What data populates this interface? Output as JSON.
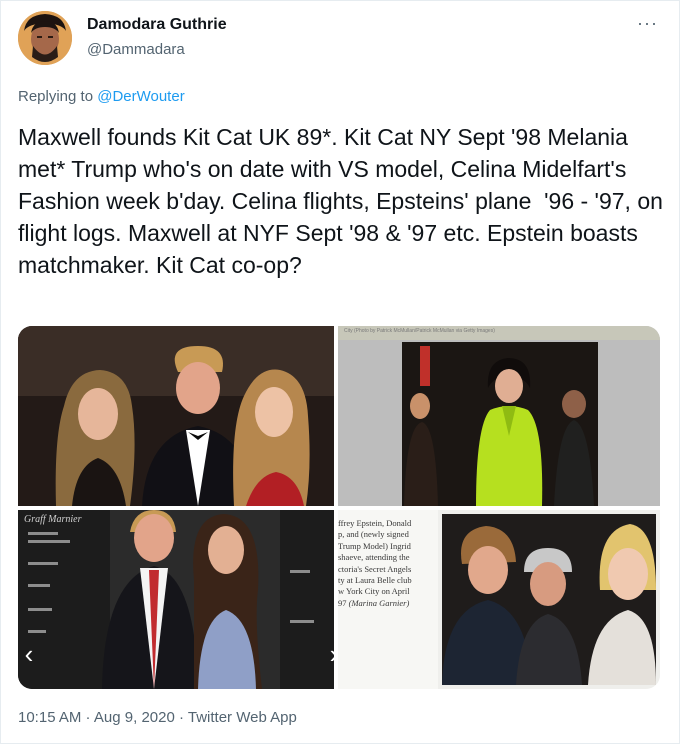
{
  "author": {
    "name": "Damodara Guthrie",
    "handle": "@Dammadara"
  },
  "reply": {
    "prefix": "Replying to ",
    "to": "@DerWouter"
  },
  "tweet_text": "Maxwell founds Kit Cat UK 89*. Kit Cat NY Sept '98 Melania met* Trump who's on date with VS model, Celina Midelfart's Fashion week b'day. Celina flights, Epsteins' plane  '96 - '97, on flight logs. Maxwell at NYF Sept '98 & '97 etc. Epstein boasts matchmaker. Kit Cat co-op?",
  "more_label": "···",
  "media": {
    "credit": "City (Photo by Patrick McMullan/Patrick McMullan via Getty Images)",
    "caption_lines": [
      "ffrey Epstein, Donald",
      "p, and (newly signed",
      "Trump Model) Ingrid",
      "shaeve, attending the",
      "ctoria's Secret Angels",
      "ty at Laura Belle club",
      "w York City on April",
      "97"
    ],
    "caption_credit": "(Marina Garnier)",
    "backdrop_brand": "Graff Marnier",
    "prev_label": "‹",
    "next_label": "›"
  },
  "meta": {
    "time": "10:15 AM",
    "date": "Aug 9, 2020",
    "source": "Twitter Web App",
    "separator": " · "
  },
  "colors": {
    "link": "#1d9bf0",
    "secondary": "#536471",
    "lime_jacket": "#b6e01f"
  }
}
